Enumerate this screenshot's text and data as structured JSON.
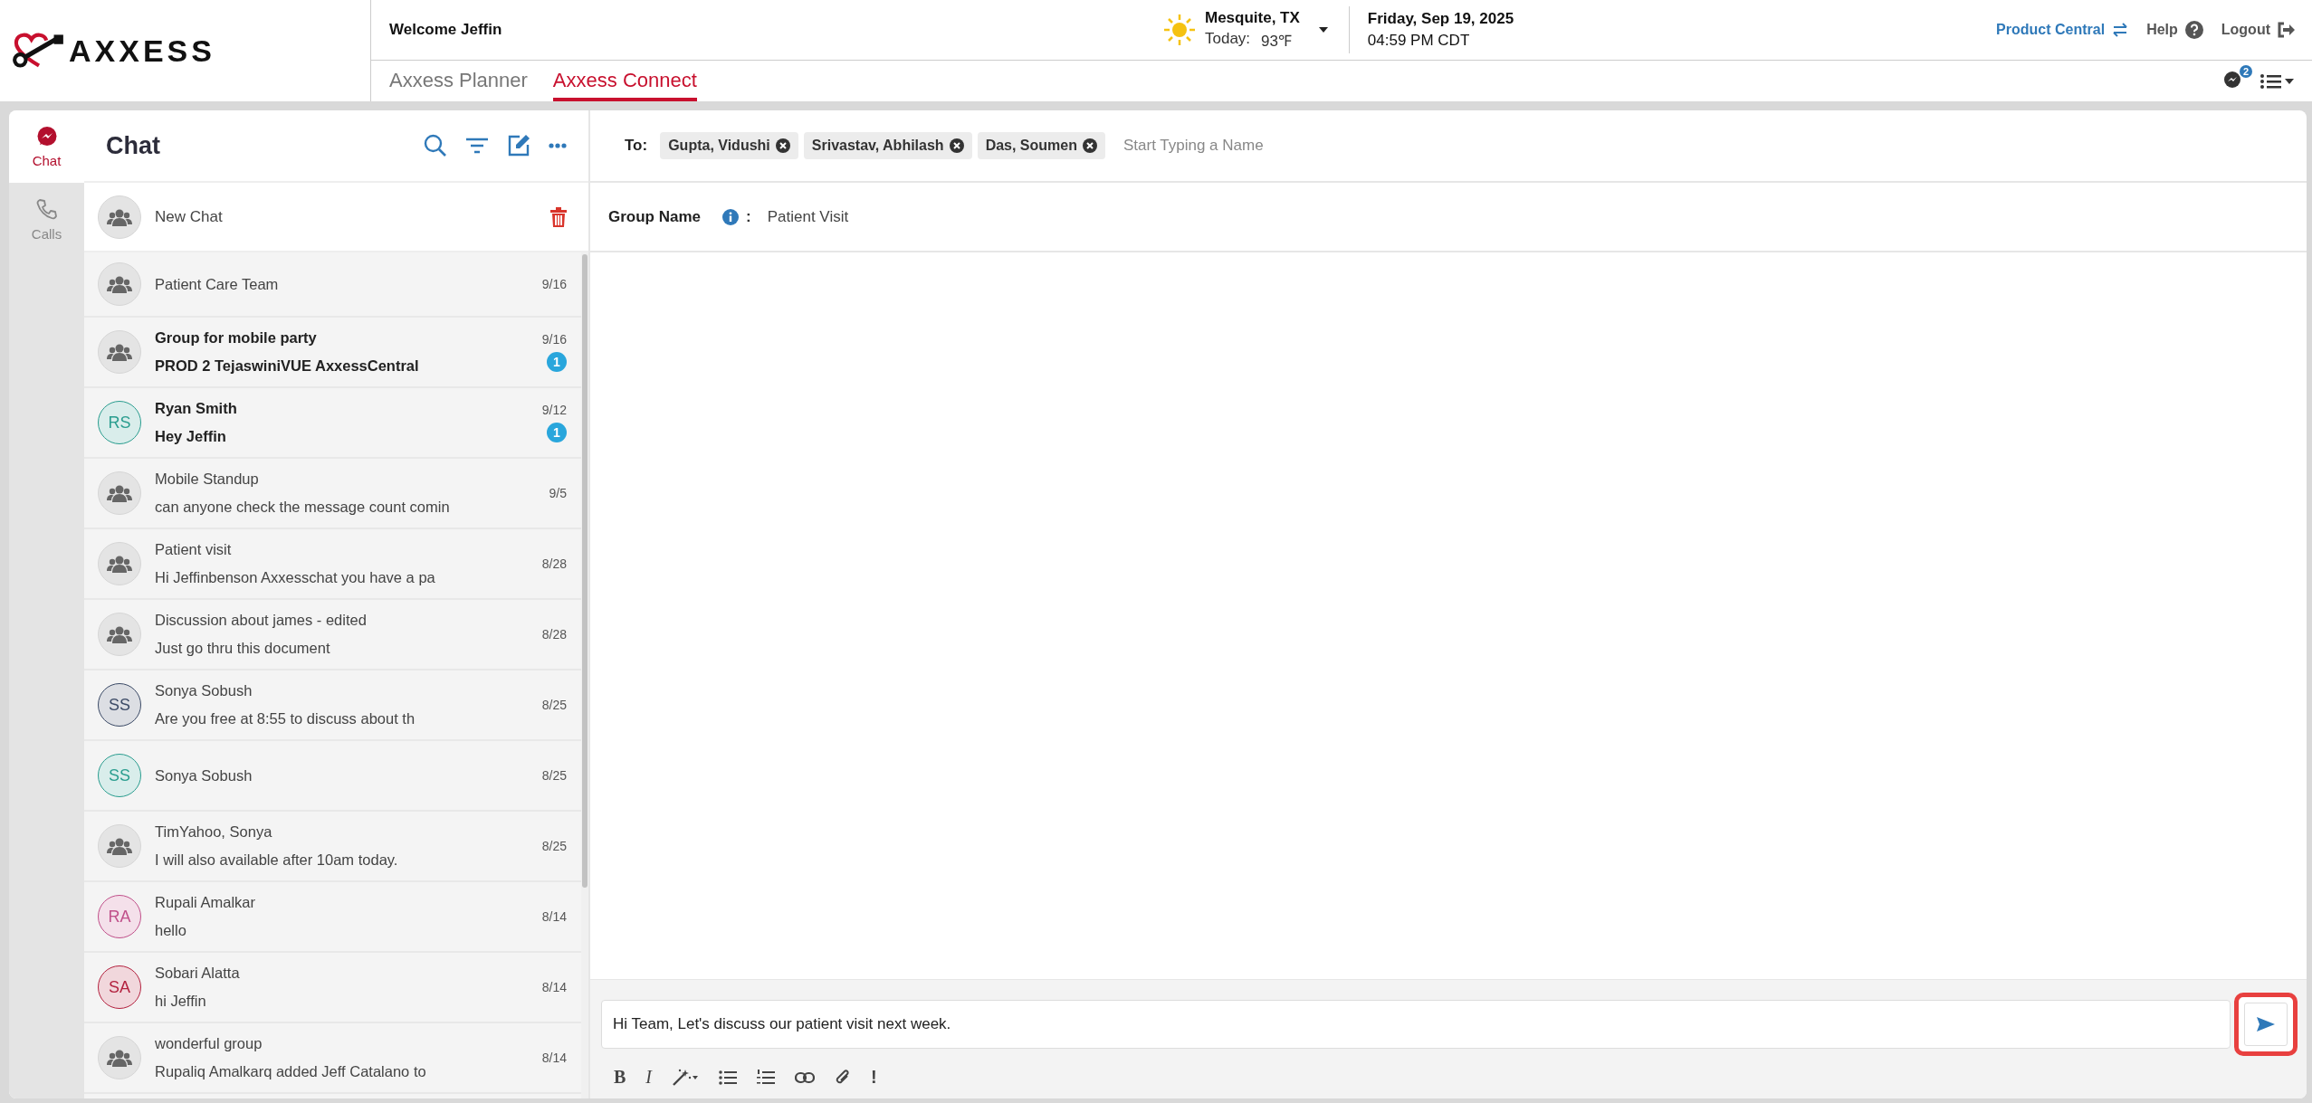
{
  "header": {
    "logo": "AXXESS",
    "welcome": "Welcome Jeffin",
    "weather": {
      "location": "Mesquite, TX",
      "today_label": "Today:",
      "temperature": "93℉"
    },
    "date": "Friday, Sep 19, 2025",
    "time": "04:59 PM CDT",
    "links": [
      {
        "label": "Product Central",
        "kind": "swap"
      },
      {
        "label": "Help",
        "kind": "help"
      },
      {
        "label": "Logout",
        "kind": "logout"
      }
    ]
  },
  "nav_tabs": [
    {
      "label": "Axxess Planner",
      "selected": false
    },
    {
      "label": "Axxess Connect",
      "selected": true
    }
  ],
  "messages_badge": "2",
  "rail": [
    {
      "label": "Chat",
      "kind": "chat",
      "selected": true
    },
    {
      "label": "Calls",
      "kind": "calls",
      "selected": false
    }
  ],
  "chat_list": {
    "title": "Chat",
    "new_chat": "New Chat",
    "items": [
      {
        "name": "Patient Care Team",
        "date": "9/16",
        "avatar": {
          "kind": "group"
        }
      },
      {
        "name": "Group for mobile party",
        "preview": "PROD 2 TejaswiniVUE AxxessCentral",
        "date": "9/16",
        "unread": "1",
        "avatar": {
          "kind": "group"
        }
      },
      {
        "name": "Ryan Smith",
        "preview": "Hey Jeffin",
        "date": "9/12",
        "unread": "1",
        "avatar": {
          "kind": "initials",
          "initials": "RS",
          "color": "#2a9d8f"
        }
      },
      {
        "name": "Mobile Standup",
        "preview": "can anyone check the message count comin",
        "date": "9/5",
        "avatar": {
          "kind": "group"
        }
      },
      {
        "name": "Patient visit",
        "preview": "Hi Jeffinbenson Axxesschat you have a pa",
        "date": "8/28",
        "avatar": {
          "kind": "group"
        }
      },
      {
        "name": "Discussion about james - edited",
        "preview": "Just go thru this document",
        "date": "8/28",
        "avatar": {
          "kind": "group"
        }
      },
      {
        "name": "Sonya Sobush",
        "preview": "Are you free at 8:55 to discuss about th",
        "date": "8/25",
        "avatar": {
          "kind": "initials",
          "initials": "SS",
          "color": "#3b4a66"
        }
      },
      {
        "name": "Sonya Sobush",
        "date": "8/25",
        "avatar": {
          "kind": "initials",
          "initials": "SS",
          "color": "#2a9d8f"
        }
      },
      {
        "name": "TimYahoo, Sonya",
        "preview": "I will also available after 10am today.",
        "date": "8/25",
        "avatar": {
          "kind": "group"
        }
      },
      {
        "name": "Rupali Amalkar",
        "preview": "hello",
        "date": "8/14",
        "avatar": {
          "kind": "initials",
          "initials": "RA",
          "color": "#c0508a"
        }
      },
      {
        "name": "Sobari Alatta",
        "preview": "hi Jeffin",
        "date": "8/14",
        "avatar": {
          "kind": "initials",
          "initials": "SA",
          "color": "#b3223f"
        }
      },
      {
        "name": "wonderful group",
        "preview": "Rupaliq Amalkarq added Jeff Catalano to",
        "date": "8/14",
        "avatar": {
          "kind": "group"
        }
      }
    ]
  },
  "compose": {
    "to_label": "To:",
    "recipients": [
      "Gupta, Vidushi",
      "Srivastav, Abhilash",
      "Das, Soumen"
    ],
    "recipient_placeholder": "Start Typing a Name",
    "group_name_label": "Group Name",
    "group_name_colon": ":",
    "group_name": "Patient Visit",
    "message": "Hi Team, Let's discuss our patient visit next week.",
    "toolbar": [
      {
        "kind": "glyph",
        "label": "B"
      },
      {
        "kind": "glyph",
        "label": "I"
      },
      {
        "kind": "wand"
      },
      {
        "kind": "bullets"
      },
      {
        "kind": "numbers"
      },
      {
        "kind": "link"
      },
      {
        "kind": "attach"
      },
      {
        "kind": "glyph",
        "label": "!"
      }
    ]
  }
}
